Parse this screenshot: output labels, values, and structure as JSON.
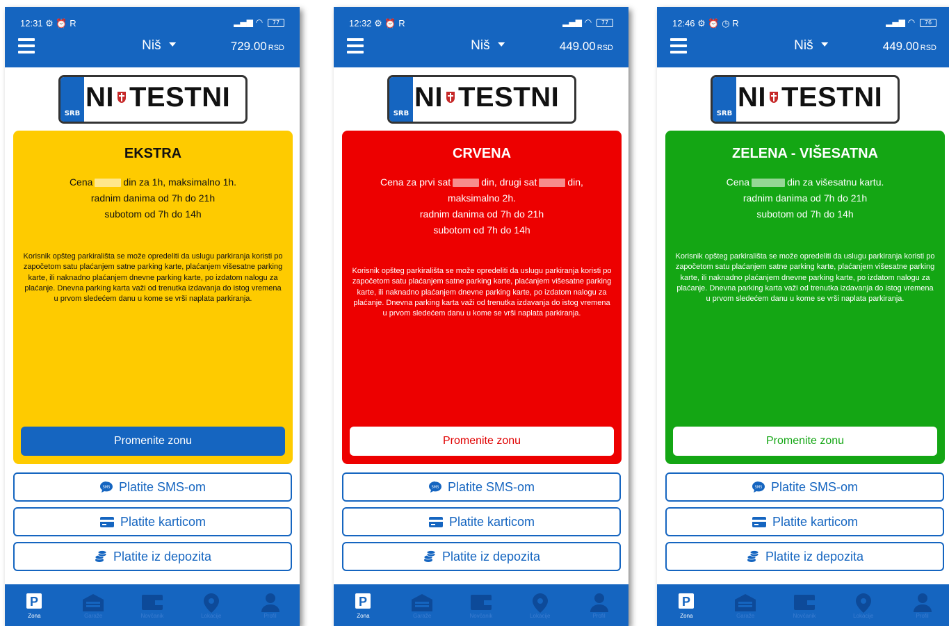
{
  "plate": {
    "country": "SRB",
    "left": "NI",
    "right": "TESTNI"
  },
  "nav": [
    {
      "label": "Zona",
      "icon": "parking-icon",
      "active": true
    },
    {
      "label": "Garaže",
      "icon": "garage-icon",
      "active": false
    },
    {
      "label": "Novčanik",
      "icon": "wallet-icon",
      "active": false
    },
    {
      "label": "Lokacije",
      "icon": "location-icon",
      "active": false
    },
    {
      "label": "Profil",
      "icon": "profile-icon",
      "active": false
    }
  ],
  "screens": [
    {
      "status_time": "12:31",
      "status_extra": "R",
      "battery": "77",
      "city": "Niš",
      "balance": "729.00",
      "currency": "RSD",
      "zone": {
        "title": "EKSTRA",
        "bg": "#fecb00",
        "text_color": "#111111",
        "info": [
          "Cena",
          "din za 1h, maksimalno 1h.",
          "radnim danima od 7h do 21h",
          "subotom od 7h do 14h"
        ],
        "description": "Korisnik opšteg parkirališta se može opredeliti da uslugu parkiranja koristi po započetom satu plaćanjem satne parking karte, plaćanjem višesatne parking karte, ili naknadno plaćanjem dnevne parking karte, po izdatom nalogu za plaćanje. Dnevna parking karta važi od trenutka izdavanja do istog vremena u prvom sledećem danu u kome se vrši naplata parkiranja.",
        "button_label": "Promenite zonu",
        "button_bg": "#1565c0",
        "button_color": "#ffffff"
      },
      "pay_buttons": [
        "Platite SMS-om",
        "Platite karticom",
        "Platite iz depozita"
      ]
    },
    {
      "status_time": "12:32",
      "status_extra": "R",
      "battery": "77",
      "city": "Niš",
      "balance": "449.00",
      "currency": "RSD",
      "zone": {
        "title": "CRVENA",
        "bg": "#ed0000",
        "text_color": "#ffffff",
        "info": [
          "Cena za prvi sat",
          "din, drugi sat",
          "din,",
          "maksimalno 2h.",
          "radnim danima od 7h do 21h",
          "subotom od 7h do 14h"
        ],
        "description": "Korisnik opšteg parkirališta se može opredeliti da uslugu parkiranja koristi po započetom satu plaćanjem satne parking karte, plaćanjem višesatne parking karte, ili naknadno plaćanjem dnevne parking karte, po izdatom nalogu za plaćanje. Dnevna parking karta važi od trenutka izdavanja do istog vremena u prvom sledećem danu u kome se vrši naplata parkiranja.",
        "button_label": "Promenite zonu",
        "button_bg": "#ffffff",
        "button_color": "#e00000"
      },
      "pay_buttons": [
        "Platite SMS-om",
        "Platite karticom",
        "Platite iz depozita"
      ]
    },
    {
      "status_time": "12:46",
      "status_extra": "R",
      "battery": "76",
      "city": "Niš",
      "balance": "449.00",
      "currency": "RSD",
      "zone": {
        "title": "ZELENA - VIŠESATNA",
        "bg": "#14a614",
        "text_color": "#ffffff",
        "info": [
          "Cena",
          "din za višesatnu kartu.",
          "radnim danima od 7h do 21h",
          "subotom od 7h do 14h"
        ],
        "description": "Korisnik opšteg parkirališta se može opredeliti da uslugu parkiranja koristi po započetom satu plaćanjem satne parking karte, plaćanjem višesatne parking karte, ili naknadno plaćanjem dnevne parking karte, po izdatom nalogu za plaćanje. Dnevna parking karta važi od trenutka izdavanja do istog vremena u prvom sledećem danu u kome se vrši naplata parkiranja.",
        "button_label": "Promenite zonu",
        "button_bg": "#ffffff",
        "button_color": "#14a614"
      },
      "pay_buttons": [
        "Platite SMS-om",
        "Platite karticom",
        "Platite iz depozita"
      ]
    }
  ]
}
